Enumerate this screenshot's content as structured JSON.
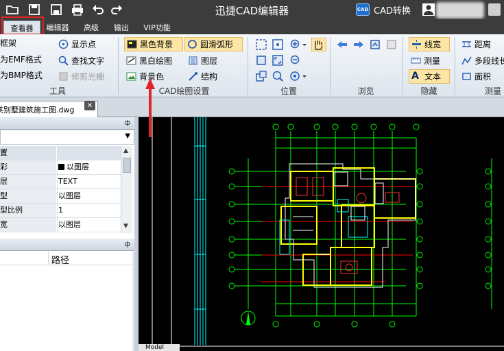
{
  "titlebar": {
    "title": "迅捷CAD编辑器",
    "cad_convert_label": "CAD转换",
    "cad_badge": "CAD",
    "quick_access": [
      "open-folder-icon",
      "save-icon",
      "save-as-icon",
      "print-icon",
      "undo-icon",
      "redo-icon"
    ]
  },
  "menu": {
    "tabs": [
      "查看器",
      "编辑器",
      "高级",
      "输出",
      "VIP功能"
    ],
    "active_tab": "查看器"
  },
  "ribbon": {
    "tools": {
      "items": [
        "框架",
        "为EMF格式",
        "为BMP格式",
        "显示点",
        "查找文字",
        "修剪光栅"
      ],
      "label": "工具"
    },
    "cad_settings": {
      "items": [
        "黑色背景",
        "黑白绘图",
        "背景色",
        "圆滑弧形",
        "图层",
        "结构"
      ],
      "label": "CAD绘图设置"
    },
    "position": {
      "label": "位置"
    },
    "browse": {
      "label": "浏览"
    },
    "hide": {
      "items": [
        "线宽",
        "测量",
        "文本"
      ],
      "label": "隐藏"
    },
    "measure": {
      "items": [
        "距离",
        "多段线长",
        "面积"
      ],
      "label": "测量"
    }
  },
  "document": {
    "tab_label": "某别墅建筑施工图.dwg",
    "close_label": "✕"
  },
  "properties": {
    "pin": "ф",
    "rows": [
      {
        "key": "置",
        "value": ""
      },
      {
        "key": "彩",
        "value": "以图层"
      },
      {
        "key": "层",
        "value": "TEXT"
      },
      {
        "key": "型",
        "value": "以图层"
      },
      {
        "key": "型比例",
        "value": "1"
      },
      {
        "key": "宽",
        "value": "以图层"
      }
    ]
  },
  "files": {
    "pin": "ф",
    "column_path": "路径"
  },
  "canvas": {
    "model_tab": "Model"
  },
  "colors": {
    "titlebar_bg": "#3c3c3c",
    "ribbon_bg": "#e6ecf2",
    "highlight_red": "#e02525",
    "cad_green": "#00ff00",
    "cad_yellow": "#ffff00",
    "cad_red": "#ff0000",
    "cad_cyan": "#00ffff"
  }
}
